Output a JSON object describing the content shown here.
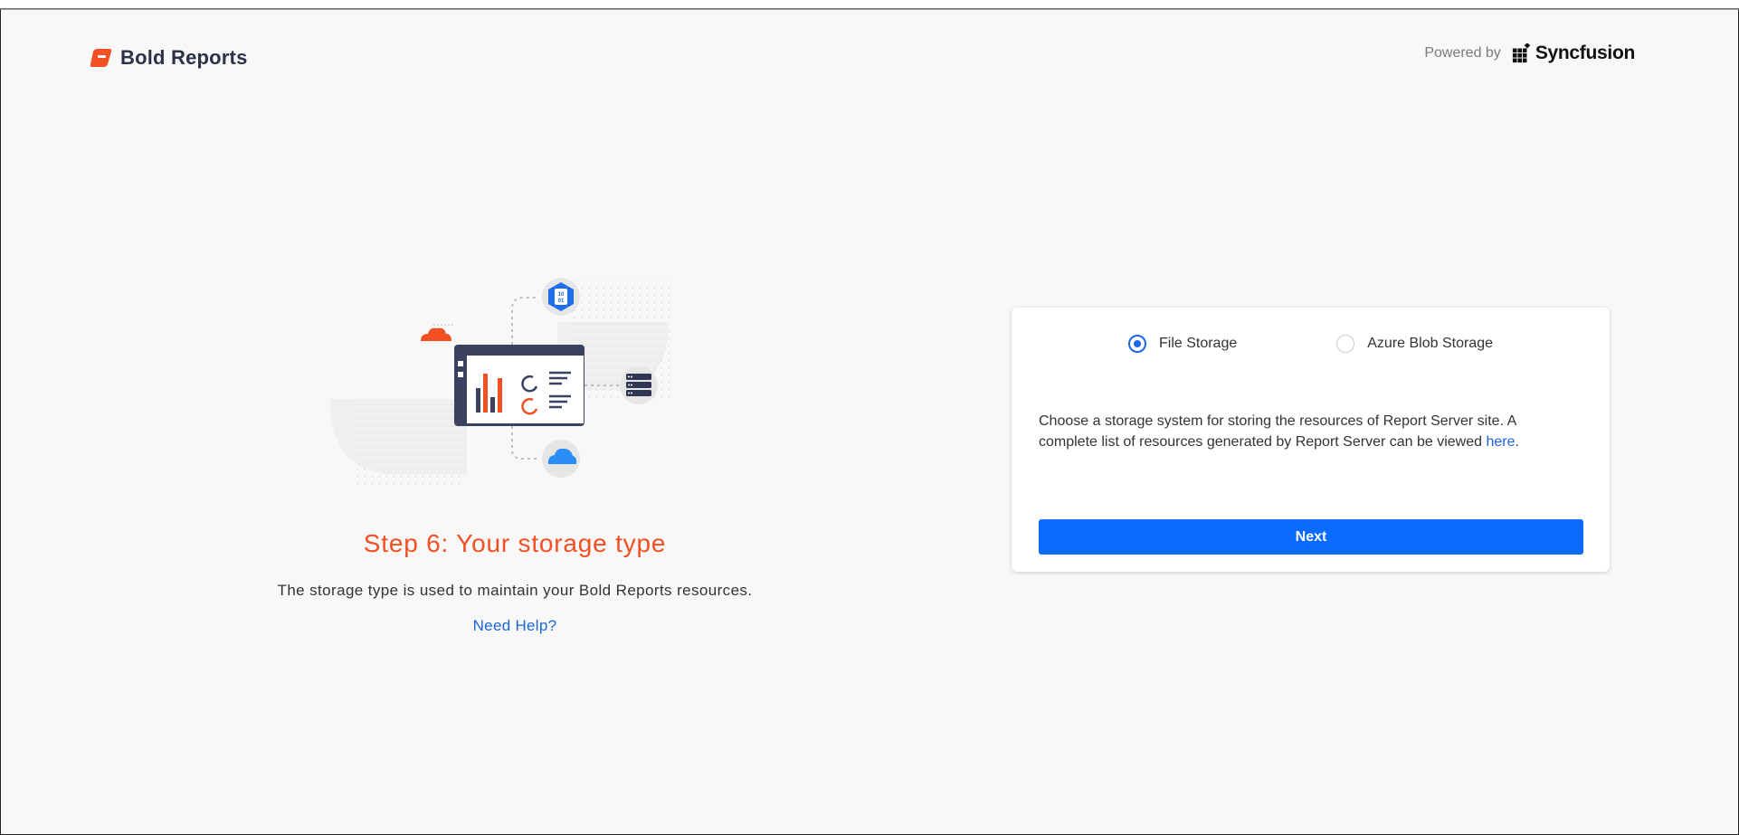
{
  "header": {
    "brand_name": "Bold Reports",
    "powered_label": "Powered by",
    "partner_name": "Syncfusion"
  },
  "step": {
    "title": "Step 6: Your storage type",
    "description": "The storage type is used to maintain your Bold Reports resources.",
    "help_link": "Need Help?"
  },
  "storage": {
    "options": [
      {
        "label": "File Storage",
        "selected": true
      },
      {
        "label": "Azure Blob Storage",
        "selected": false
      }
    ],
    "description_before_link": "Choose a storage system for storing the resources of Report Server site. A complete list of resources generated by Report Server can be viewed ",
    "link_text": "here",
    "description_after_link": ".",
    "next_label": "Next"
  },
  "illustration": {
    "hex_badge_text_top": "10",
    "hex_badge_text_bottom": "01"
  },
  "colors": {
    "accent_orange": "#f25022",
    "primary_blue": "#0a6cff",
    "brand_dark": "#2b3148",
    "cloud_blue": "#2a8df5"
  }
}
